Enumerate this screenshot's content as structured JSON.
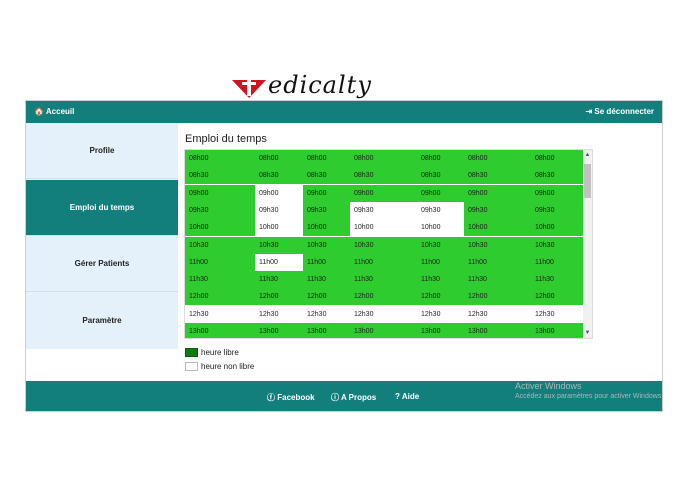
{
  "brand": {
    "text": "edicalty",
    "accent": "#d01420"
  },
  "topbar": {
    "home_label": "Acceuil",
    "logout_label": "Se déconnecter"
  },
  "sidebar": {
    "items": [
      {
        "label": "Profile",
        "active": false
      },
      {
        "label": "Emploi du temps",
        "active": true
      },
      {
        "label": "Gérer Patients",
        "active": false
      },
      {
        "label": "Paramètre",
        "active": false
      }
    ]
  },
  "main": {
    "title": "Emploi du temps",
    "rows": [
      [
        "08h00",
        "08h00",
        "08h00",
        "08h00",
        "08h00",
        "08h00",
        "08h00"
      ],
      [
        "08h30",
        "08h30",
        "08h30",
        "08h30",
        "08h30",
        "08h30",
        "08h30"
      ],
      [
        "09h00",
        "09h00",
        "09h00",
        "09h00",
        "09h00",
        "09h00",
        "09h00"
      ],
      [
        "09h30",
        "09h30",
        "09h30",
        "09h30",
        "09h30",
        "09h30",
        "09h30"
      ],
      [
        "10h00",
        "10h00",
        "10h00",
        "10h00",
        "10h00",
        "10h00",
        "10h00"
      ],
      [
        "10h30",
        "10h30",
        "10h30",
        "10h30",
        "10h30",
        "10h30",
        "10h30"
      ],
      [
        "11h00",
        "11h00",
        "11h00",
        "11h00",
        "11h00",
        "11h00",
        "11h00"
      ],
      [
        "11h30",
        "11h30",
        "11h30",
        "11h30",
        "11h30",
        "11h30",
        "11h30"
      ],
      [
        "12h00",
        "12h00",
        "12h00",
        "12h00",
        "12h00",
        "12h00",
        "12h00"
      ],
      [
        "12h30",
        "12h30",
        "12h30",
        "12h30",
        "12h30",
        "12h30",
        "12h30"
      ],
      [
        "13h00",
        "13h00",
        "13h00",
        "13h00",
        "13h00",
        "13h00",
        "13h00"
      ]
    ],
    "busy": [
      [
        0,
        0,
        0,
        0,
        0,
        0,
        0
      ],
      [
        0,
        0,
        0,
        0,
        0,
        0,
        0
      ],
      [
        0,
        1,
        0,
        0,
        0,
        0,
        0
      ],
      [
        0,
        1,
        0,
        1,
        1,
        0,
        0
      ],
      [
        0,
        1,
        0,
        1,
        1,
        0,
        0
      ],
      [
        0,
        0,
        0,
        0,
        0,
        0,
        0
      ],
      [
        0,
        1,
        0,
        0,
        0,
        0,
        0
      ],
      [
        0,
        0,
        0,
        0,
        0,
        0,
        0
      ],
      [
        0,
        0,
        0,
        0,
        0,
        0,
        0
      ],
      [
        1,
        1,
        1,
        1,
        1,
        1,
        1
      ],
      [
        0,
        0,
        0,
        0,
        0,
        0,
        0
      ]
    ],
    "colors": {
      "free": "#2ecc2e",
      "busy": "#ffffff"
    }
  },
  "legend": {
    "free_label": "heure libre",
    "busy_label": "heure non libre"
  },
  "footer": {
    "facebook": "Facebook",
    "about": "A Propos",
    "help": "Aide"
  },
  "watermark": {
    "title": "Activer Windows",
    "subtitle": "Accédez aux paramètres pour activer Windows."
  }
}
